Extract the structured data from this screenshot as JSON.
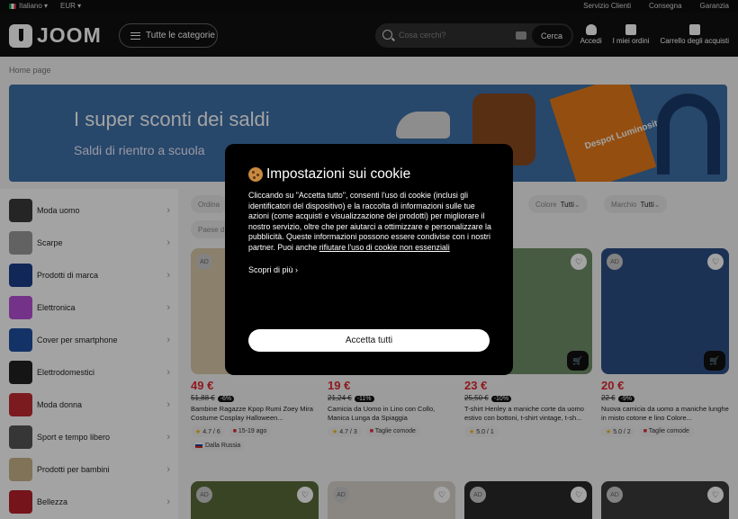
{
  "topbar": {
    "language": "Italiano",
    "currency": "EUR",
    "links": [
      "Servizio Clienti",
      "Consegna",
      "Garanzia"
    ]
  },
  "header": {
    "logo": "JOOM",
    "categories_button": "Tutte le categorie",
    "search_placeholder": "Cosa cerchi?",
    "search_button": "Cerca",
    "login": "Accedi",
    "orders": "I miei ordini",
    "cart": "Carrello degli acquisti"
  },
  "breadcrumb": "Home page",
  "banner": {
    "title": "I super sconti dei saldi",
    "subtitle": "Saldi di rientro a scuola",
    "product_text": "Despot Luminosity"
  },
  "sidebar": {
    "items": [
      {
        "label": "Moda uomo",
        "color": "#3a3a3a"
      },
      {
        "label": "Scarpe",
        "color": "#9a9a9a"
      },
      {
        "label": "Prodotti di marca",
        "color": "#1a3d8a"
      },
      {
        "label": "Elettronica",
        "color": "#b84fd6"
      },
      {
        "label": "Cover per smartphone",
        "color": "#1f4fa0"
      },
      {
        "label": "Elettrodomestici",
        "color": "#222222"
      },
      {
        "label": "Moda donna",
        "color": "#c02b33"
      },
      {
        "label": "Sport e tempo libero",
        "color": "#555555"
      },
      {
        "label": "Prodotti per bambini",
        "color": "#c9b48a"
      },
      {
        "label": "Bellezza",
        "color": "#b8202a"
      }
    ]
  },
  "filters": {
    "sort_label": "Ordina",
    "country_label": "Paese d",
    "color_label": "Colore",
    "color_value": "Tutti",
    "brand_label": "Marchio",
    "brand_value": "Tutti"
  },
  "products": [
    {
      "ad": "AD",
      "price": "49 €",
      "old_price": "51,88 €",
      "discount": "-6%",
      "name": "Bambine Ragazze Kpop Rumi Zoey Mira Costume Cosplay Halloween...",
      "rating": "4.7",
      "reviews": "6",
      "delivery": "15-19 ago",
      "origin": "Dalla Russia",
      "color": "#d8c8a8"
    },
    {
      "ad": "AD",
      "price": "19 €",
      "old_price": "21,24 €",
      "discount": "-11%",
      "name": "Camicia da Uomo in Lino con Collo, Manica Lunga da Spiaggia",
      "rating": "4.7",
      "reviews": "3",
      "delivery": "Taglie comode",
      "color": "#e8e4dc"
    },
    {
      "ad": "AD",
      "price": "23 €",
      "old_price": "25,50 €",
      "discount": "-10%",
      "name": "T-shirt Henley a maniche corte da uomo estivo con bottoni, t-shirt vintage, t-sh...",
      "rating": "5.0",
      "reviews": "1",
      "color": "#6f8f6a"
    },
    {
      "ad": "AD",
      "price": "20 €",
      "old_price": "22 €",
      "discount": "-9%",
      "name": "Nuova camicia da uomo a maniche lunghe in misto cotone e lino Colore...",
      "rating": "5.0",
      "reviews": "2",
      "delivery": "Taglie comode",
      "color": "#2d4f86"
    }
  ],
  "products_row2": [
    {
      "ad": "AD",
      "color": "#5a6b3a"
    },
    {
      "ad": "AD",
      "color": "#d8d4cc"
    },
    {
      "ad": "AD",
      "color": "#2a2a2a"
    },
    {
      "ad": "AD",
      "color": "#3a3a3a"
    }
  ],
  "cookie_modal": {
    "title": "Impostazioni sui cookie",
    "body": "Cliccando su \"Accetta tutto\", consenti l'uso di cookie (inclusi gli identificatori del dispositivo) e la raccolta di informazioni sulle tue azioni (come acquisti e visualizzazione dei prodotti) per migliorare il nostro servizio, oltre che per aiutarci a ottimizzare e personalizzare la pubblicità. Queste informazioni possono essere condivise con i nostri partner. Puoi anche",
    "reject_link": "rifiutare l'uso di cookie non essenziali",
    "learn_more": "Scopri di più",
    "accept_button": "Accetta tutti"
  }
}
